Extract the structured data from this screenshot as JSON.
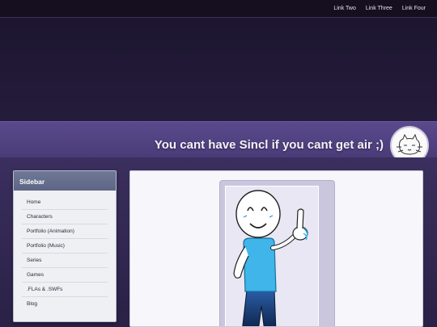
{
  "topnav": {
    "links": [
      "Link Two",
      "Link Three",
      "Link Four"
    ]
  },
  "banner": {
    "title": "You cant have Sincl if you cant get air ;)"
  },
  "sidebar": {
    "heading": "Sidebar",
    "items": [
      {
        "label": "Home"
      },
      {
        "label": "Characters"
      },
      {
        "label": "Portfolio (Animation)"
      },
      {
        "label": "Portfolio (Music)"
      },
      {
        "label": "Series"
      },
      {
        "label": "Games"
      },
      {
        "label": ".FLAs & .SWFs"
      },
      {
        "label": "Blog"
      }
    ]
  },
  "icons": {
    "avatar": "cat-doodle-avatar-icon",
    "character": "stick-figure-thumbs-up-image"
  },
  "colors": {
    "topnav_bg": "#150f20",
    "banner": "#4a3b78",
    "sidebar_header": "#6f7896",
    "page_bg": "#221a36"
  }
}
